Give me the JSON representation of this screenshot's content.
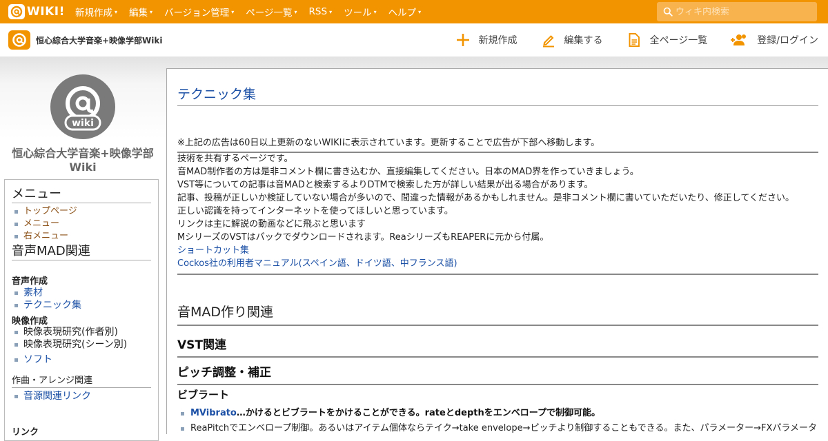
{
  "topbar": {
    "logo_text": "WIKI!",
    "menu": [
      {
        "label": "新規作成"
      },
      {
        "label": "編集"
      },
      {
        "label": "バージョン管理"
      },
      {
        "label": "ページ一覧"
      },
      {
        "label": "RSS"
      },
      {
        "label": "ツール"
      },
      {
        "label": "ヘルプ"
      }
    ],
    "caret": "▾",
    "search_placeholder": "ウィキ内検索",
    "colors": {
      "bar": "#f29400",
      "search_bg": "#f8b34f"
    }
  },
  "subbar": {
    "site_name": "恒心綜合大学音楽+映像学部Wiki",
    "actions": [
      {
        "label": "新規作成",
        "icon": "plus-icon"
      },
      {
        "label": "編集する",
        "icon": "pencil-icon"
      },
      {
        "label": "全ページ一覧",
        "icon": "document-icon"
      },
      {
        "label": "登録/ログイン",
        "icon": "user-add-icon"
      }
    ]
  },
  "sidebar": {
    "title": "恒心綜合大学音楽+映像学部Wiki",
    "menu_heading": "メニュー",
    "menu_links": [
      "トップページ",
      "メニュー",
      "右メニュー"
    ],
    "section_heading": "音声MAD関連",
    "sub1": "音声作成",
    "sub1_links": [
      "素材",
      "テクニック集"
    ],
    "sub2": "映像作成",
    "sub2_items": [
      "映像表現研究(作者別)",
      "映像表現研究(シーン別)"
    ],
    "sub2_link": "ソフト",
    "sub3": "作曲・アレンジ関連",
    "sub3_link": "音源関連リンク",
    "sub4": "リンク"
  },
  "main": {
    "title": "テクニック集",
    "notice": "※上記の広告は60日以上更新のないWIKIに表示されています。更新することで広告が下部へ移動します。",
    "lines": [
      "技術を共有するページです。",
      "音MAD制作者の方は是非コメント欄に書き込むか、直接編集してください。日本のMAD界を作っていきましょう。",
      "VST等についての記事は音MADと検索するよりDTMで検索した方が詳しい結果が出る場合があります。",
      "記事、投稿が正しいか検証していない場合が多いので、間違った情報があるかもしれません。是非コメント欄に書いていただいたり、修正してください。",
      "正しい認識を持ってインターネットを使ってほしいと思っています。",
      "リンクは主に解説の動画などに飛ぶと思います",
      "MシリーズのVSTはパックでダウンロードされます。ReaシリーズもREAPERに元から付属。"
    ],
    "links": [
      "ショートカット集",
      "Cockos社の利用者マニュアル(スペイン語、ドイツ語、中フランス語)"
    ],
    "h2": "音MAD作り関連",
    "h3a": "VST関連",
    "h3b": "ピッチ調整・補正",
    "h4": "ビブラート",
    "bullets": [
      {
        "link": "MVibrato",
        "text": "…かけるとビブラートをかけることができる。rateとdepthをエンベロープで制御可能。"
      },
      {
        "text": "ReaPitchでエンベロープ制御。あるいはアイテム個体ならテイク→take envelope→ピッチより制御することもできる。また、パラメーター→FXパラメータ"
      }
    ]
  }
}
